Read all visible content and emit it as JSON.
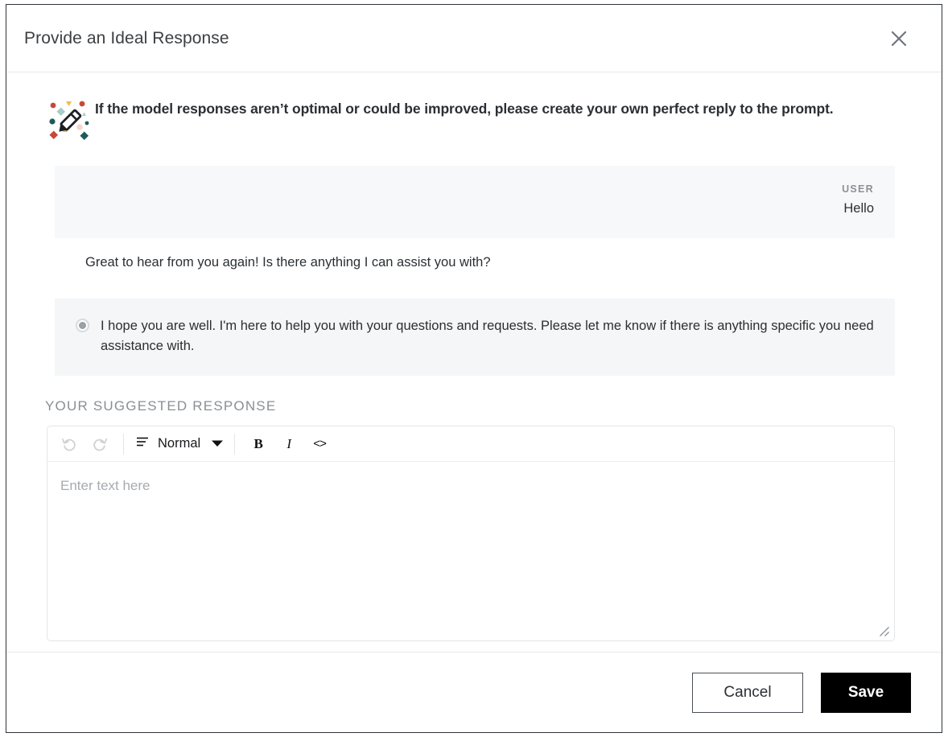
{
  "modal": {
    "title": "Provide an Ideal Response",
    "close_icon": "close-icon"
  },
  "banner": {
    "icon": "pencil-sparkle-icon",
    "text": "If the model responses aren’t optimal or could be improved, please create your own perfect reply to the prompt."
  },
  "conversation": {
    "user_message": {
      "role_label": "USER",
      "text": "Hello"
    },
    "responses": [
      {
        "text": "Great to hear from you again! Is there anything I can assist you with?",
        "has_radio": false,
        "selected": false
      },
      {
        "text": "I hope you are well. I'm here to help you with your questions and requests. Please let me know if there is anything specific you need assistance with.",
        "has_radio": true,
        "selected": true
      }
    ]
  },
  "suggested": {
    "section_label": "YOUR SUGGESTED RESPONSE",
    "toolbar": {
      "undo_icon": "undo-icon",
      "redo_icon": "redo-icon",
      "paragraph_icon": "paragraph-align-icon",
      "style_label": "Normal",
      "caret_icon": "chevron-down-icon",
      "bold_label": "B",
      "italic_label": "I",
      "code_label": "<>"
    },
    "editor": {
      "placeholder": "Enter text here",
      "value": "",
      "resize_icon": "resize-handle-icon"
    }
  },
  "footer": {
    "cancel_label": "Cancel",
    "save_label": "Save"
  },
  "colors": {
    "modal_border": "#2f3338",
    "save_bg": "#000000",
    "user_bubble_bg": "#f7f8f9",
    "option_shaded_bg": "#f4f6f7",
    "muted_text": "#8a8f94",
    "confetti_red": "#c8483a",
    "confetti_yellow": "#f0c040",
    "confetti_teal": "#1f5b5b",
    "confetti_lightteal": "#a9cdc8",
    "confetti_pink": "#f6d6cd"
  }
}
